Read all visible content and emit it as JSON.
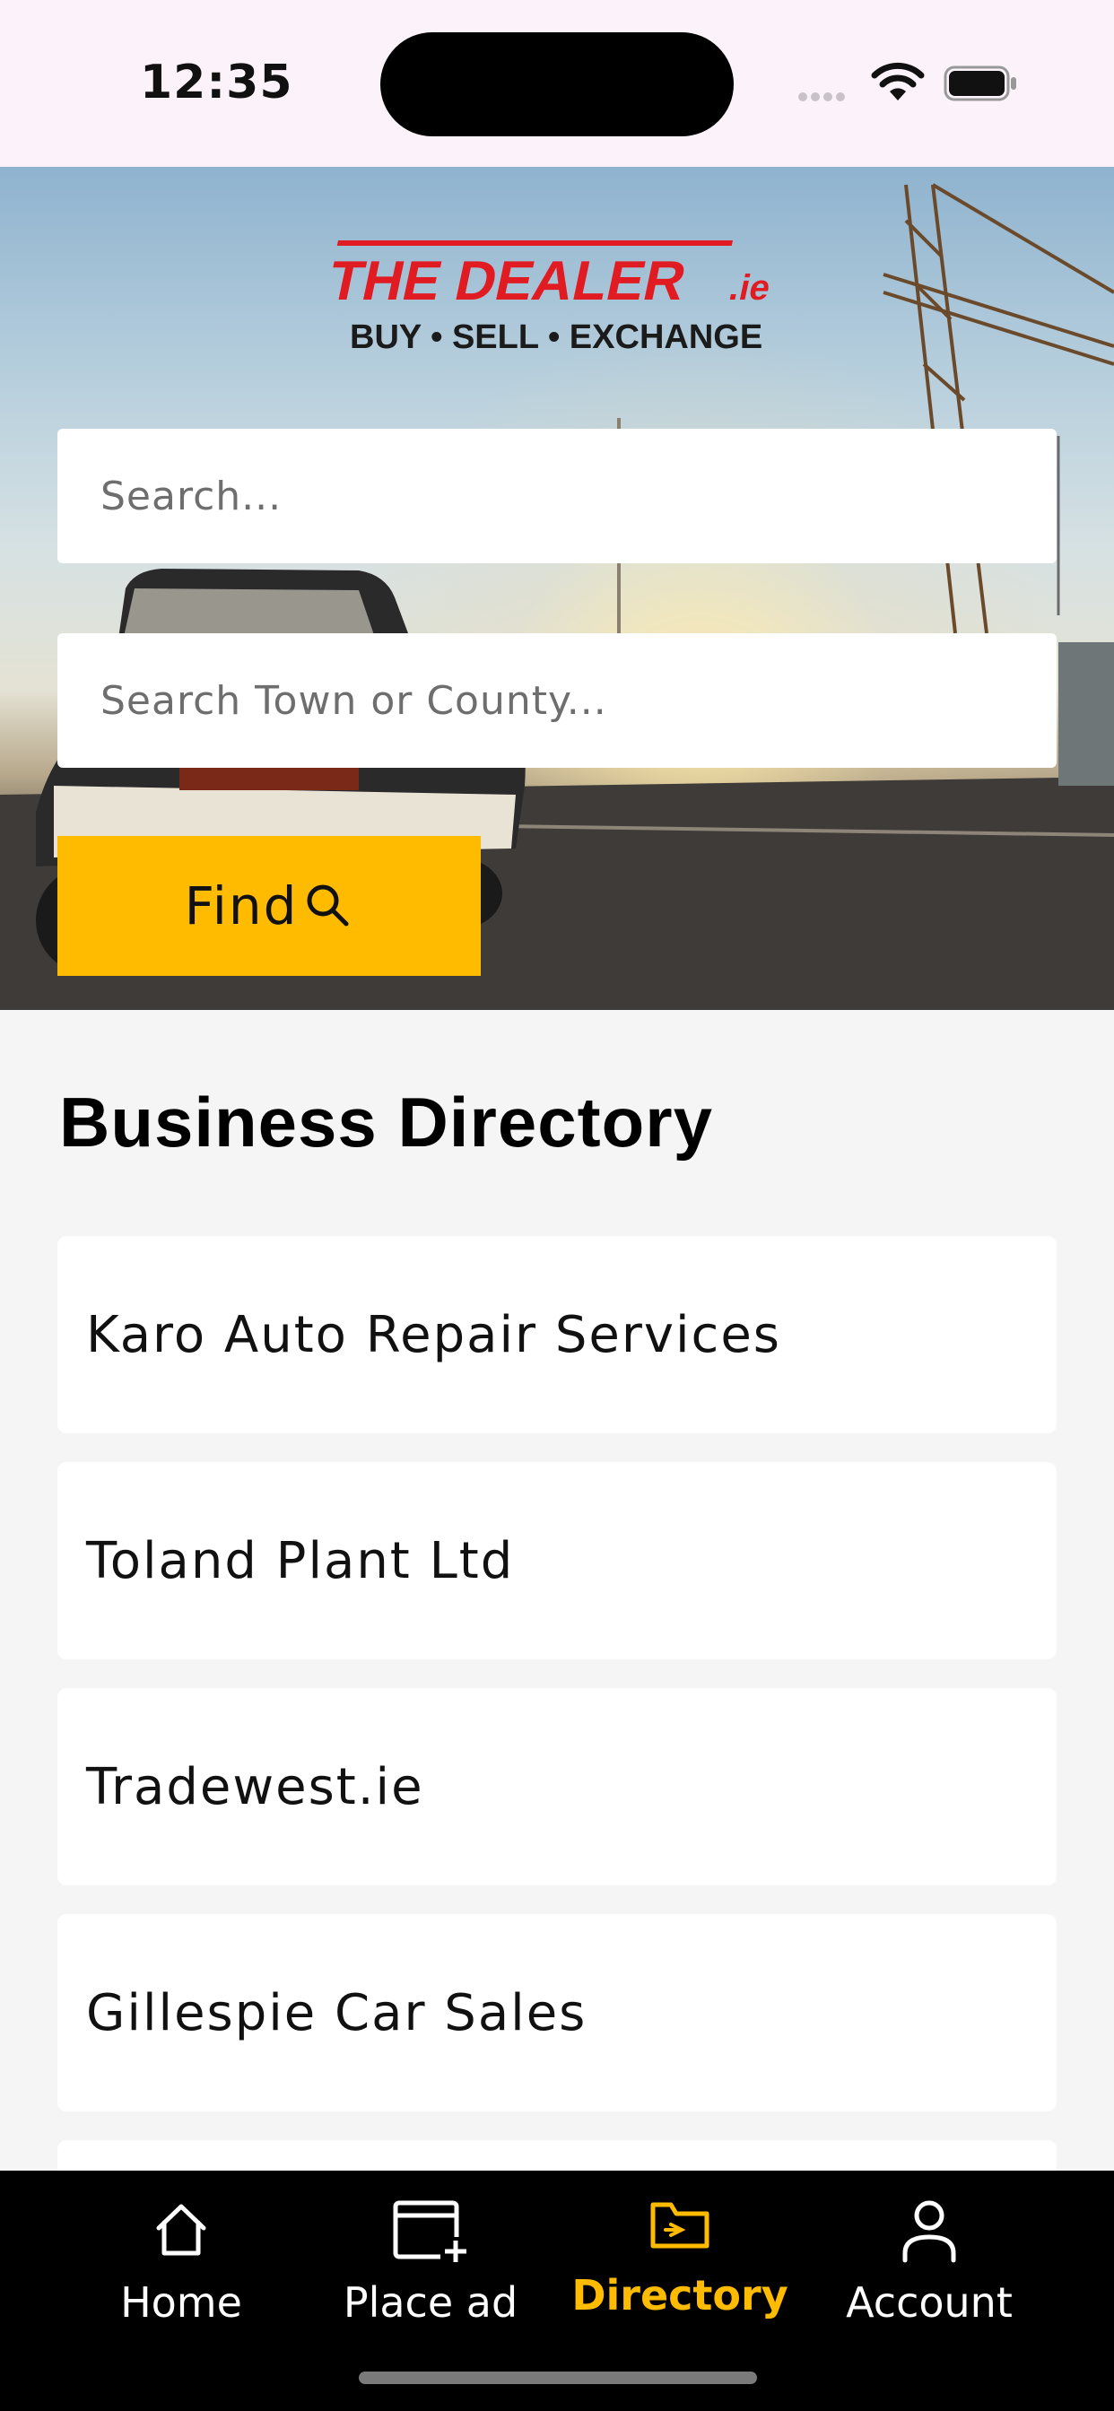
{
  "status_bar": {
    "time": "12:35"
  },
  "header": {
    "logo": {
      "brand": "THE DEALER",
      "suffix": ".ie",
      "tagline": "BUY • SELL • EXCHANGE"
    },
    "search": {
      "placeholder": "Search..."
    },
    "location": {
      "placeholder": "Search Town or County..."
    },
    "find_label": "Find"
  },
  "directory": {
    "title": "Business Directory",
    "items": [
      {
        "name": "Karo Auto Repair Services"
      },
      {
        "name": "Toland Plant Ltd"
      },
      {
        "name": "Tradewest.ie"
      },
      {
        "name": "Gillespie Car Sales"
      },
      {
        "name": ""
      }
    ]
  },
  "nav": {
    "items": [
      {
        "label": "Home",
        "icon": "home-icon"
      },
      {
        "label": "Place ad",
        "icon": "place-ad-icon"
      },
      {
        "label": "Directory",
        "icon": "directory-icon",
        "active": true
      },
      {
        "label": "Account",
        "icon": "account-icon"
      }
    ]
  },
  "colors": {
    "accent": "#ffbb00",
    "logo_red": "#e11b22",
    "nav_bg": "#000000"
  }
}
